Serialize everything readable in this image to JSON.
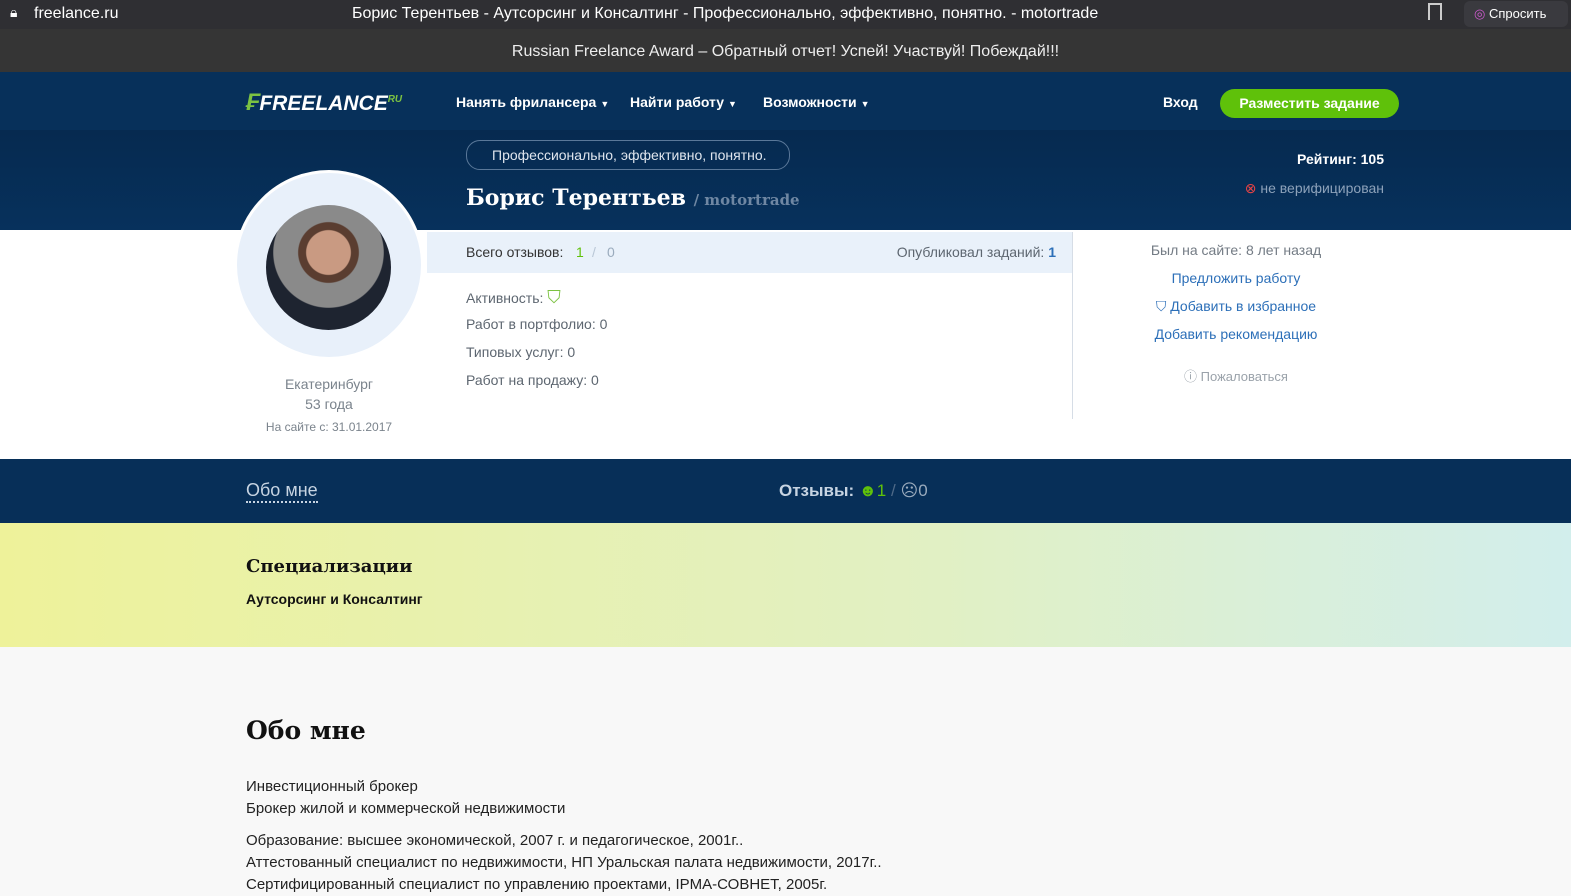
{
  "browser": {
    "url": "freelance.ru",
    "title": "Борис Терентьев - Аутсорсинг и Консалтинг - Профессионально, эффективно, понятно. - motortrade",
    "ask": "Спросить"
  },
  "announcement": "Russian Freelance Award – Обратный отчет! Успей! Участвуй! Побеждай!!!",
  "nav": {
    "logo": "FREELANCE",
    "logo_suffix": "RU",
    "items": [
      "Нанять фрилансера",
      "Найти работу",
      "Возможности"
    ],
    "login": "Вход",
    "post": "Разместить задание"
  },
  "profile": {
    "slogan": "Профессионально, эффективно, понятно.",
    "name": "Борис Терентьев",
    "username": "/ motortrade",
    "rating": "Рейтинг: 105",
    "verified": "не верифицирован",
    "city": "Екатеринбург",
    "age": "53 года",
    "since": "На сайте с: 31.01.2017",
    "reviews_label": "Всего отзывов:",
    "reviews_pos": "1",
    "reviews_sep": "/",
    "reviews_neg": "0",
    "tasks_label": "Опубликовал заданий:",
    "tasks": "1",
    "activity": "Активность:",
    "portfolio": "Работ в портфолио: 0",
    "services": "Типовых услуг: 0",
    "sales": "Работ на продажу: 0",
    "last_seen": "Был на сайте: 8 лет назад",
    "offer": "Предложить работу",
    "favorite": "Добавить в избранное",
    "recommend": "Добавить рекомендацию",
    "complain": "Пожаловаться"
  },
  "tabs": {
    "about": "Обо мне",
    "reviews": "Отзывы:",
    "pos": "1",
    "sep": "/",
    "neg": "0"
  },
  "spec": {
    "title": "Специализации",
    "value": "Аутсорсинг и Консалтинг"
  },
  "about": {
    "title": "Обо мне",
    "lines": [
      "Инвестиционный брокер",
      "Брокер жилой и коммерческой недвижимости",
      "Образование: высшее экономической, 2007 г. и педагогическое, 2001г..",
      "Аттестованный специалист по недвижимости, НП Уральская палата недвижимости, 2017г..",
      "Сертифицированный специалист по управлению проектами, IPMA-СОВНЕТ, 2005г."
    ]
  }
}
